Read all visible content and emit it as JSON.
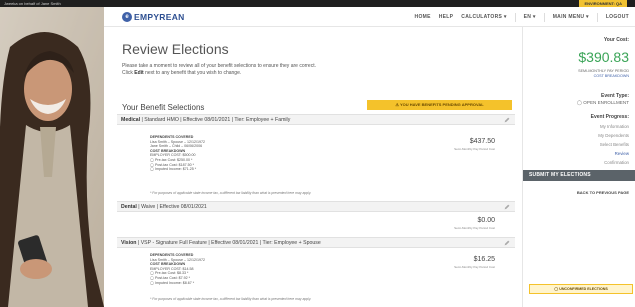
{
  "topbar": {
    "note": "Jweeka on behalf of Jane Smith",
    "environment": "ENVIRONMENT: QA"
  },
  "brand": {
    "logo_text": "EMPYREAN"
  },
  "nav": {
    "items": [
      "HOME",
      "HELP",
      "CALCULATORS ▾",
      "EN ▾",
      "MAIN MENU ▾",
      "LOGOUT"
    ]
  },
  "page": {
    "title": "Review Elections",
    "intro_line1": "Please take a moment to review all of your benefit selections to ensure they are correct.",
    "intro_line2_pre": "Click",
    "intro_line2_bold": "Edit",
    "intro_line2_post": "next to any benefit that you wish to change."
  },
  "selections": {
    "heading": "Your Benefit Selections",
    "pending_badge": "⚠ YOU HAVE BENEFITS PENDING APPROVAL"
  },
  "medical": {
    "header_bold": "Medical",
    "header_rest": " | Standard HMO | Effective 08/01/2021 | Tier: Employee + Family",
    "dependents_title": "DEPENDENTS COVERED",
    "dependents": [
      "Lisa Smith – Spouse – 12/12/1972",
      "Jane Smith – Child – 06/06/2006"
    ],
    "cost_title": "COST BREAKDOWN",
    "cost_lines": [
      "EMPLOYER COST: $500.00",
      "◯ Pre-tax Cost: $250.00 *",
      "◯ Post-tax Cost: $187.50 *",
      "◯ Imputed Income: $71.25 *"
    ],
    "price": "$437.50",
    "price_sub": "Semi-Monthly Pay Period Cost",
    "footnote": "* For purposes of applicable state income tax, a different tax liability than what is presented here may apply."
  },
  "dental": {
    "header_bold": "Dental",
    "header_rest": " | Waive | Effective 08/01/2021",
    "price": "$0.00",
    "price_sub": "Semi-Monthly Pay Period Cost"
  },
  "vision": {
    "header_bold": "Vision",
    "header_rest": " | VSP - Signature Full Feature | Effective 08/01/2021 | Tier: Employee + Spouse",
    "dependents_title": "DEPENDENTS COVERED",
    "dependents": [
      "Lisa Smith – Spouse – 12/12/1972"
    ],
    "cost_title": "COST BREAKDOWN",
    "cost_lines": [
      "EMPLOYER COST: $14.58",
      "◯ Pre-tax Cost: $8.33 *",
      "◯ Post-tax Cost: $7.92 *",
      "◯ Imputed Income: $8.67 *"
    ],
    "price": "$16.25",
    "price_sub": "Semi-Monthly Pay Period Cost",
    "footnote": "* For purposes of applicable state income tax, a different tax liability than what is presented here may apply."
  },
  "sidebar": {
    "cost_label": "Your Cost:",
    "cost_value": "$390.83",
    "cost_period": "SEMI-MONTHLY PAY PERIOD",
    "cost_link": "COST BREAKDOWN",
    "event_label": "Event Type:",
    "event_value": "◯ OPEN ENROLLMENT",
    "progress_label": "Event Progress:",
    "progress_steps": [
      "My Information",
      "My Dependents",
      "Select Benefits",
      "Review",
      "Confirmation"
    ],
    "submit": "SUBMIT MY ELECTIONS",
    "back": "BACK TO PREVIOUS PAGE",
    "unconfirmed": "◯ UNCONFIRMED ELECTIONS"
  },
  "colors": {
    "brand": "#2d4f91",
    "accent_green": "#3aa457",
    "warning": "#f4c22b",
    "submit_bg": "#5b6369"
  }
}
